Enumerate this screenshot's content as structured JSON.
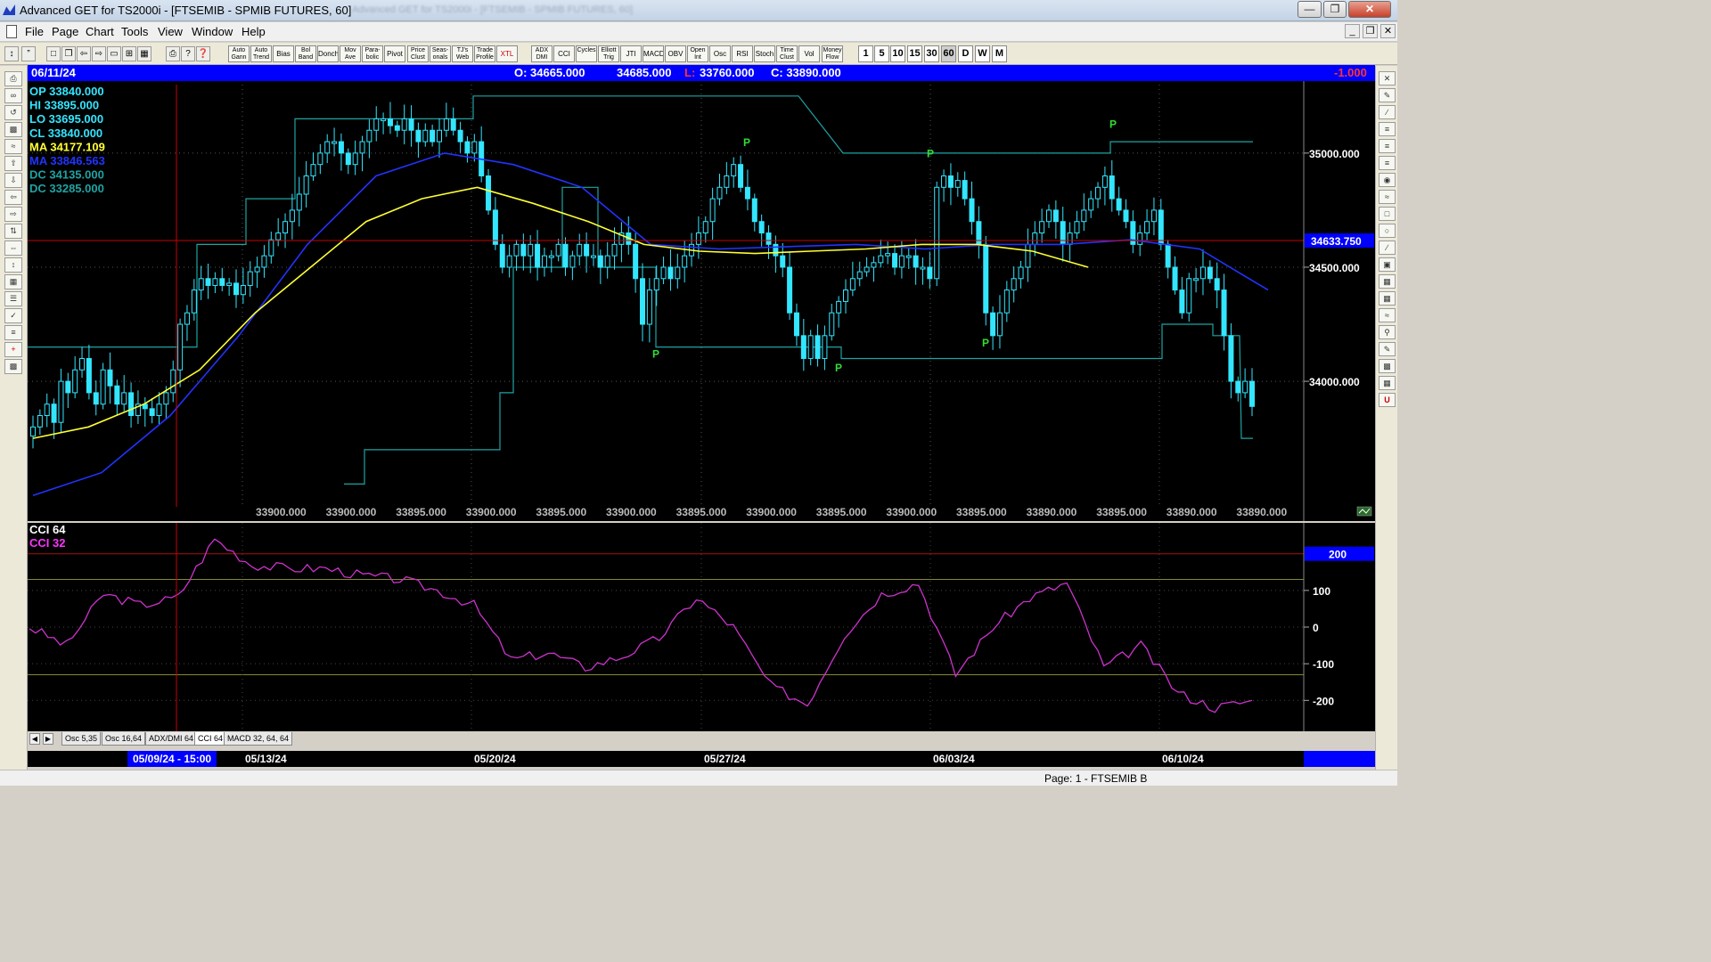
{
  "window": {
    "title": "Advanced GET for TS2000i - [FTSEMIB - SPMIB FUTURES, 60]",
    "blurred_text": "Advanced GET for TS2000i - [FTSEMIB - SPMIB FUTURES, 60]"
  },
  "menu": [
    "File",
    "Page",
    "Chart",
    "Tools",
    "View",
    "Window",
    "Help"
  ],
  "toolbar": {
    "studies": [
      "Auto Gann",
      "Auto Trend",
      "Bias",
      "Bol Band",
      "Donch",
      "Mov Ave",
      "Para-bolic",
      "Pivot",
      "Price Clust",
      "Seas-onals",
      "TJ's Web",
      "Trade Profile",
      "XTL",
      "ADX DMI",
      "CCI",
      "Cycles",
      "Elliott Trig",
      "JTI",
      "MACD",
      "OBV",
      "Open Int",
      "Osc",
      "RSI",
      "Stoch",
      "Time Clust",
      "Vol",
      "Money Flow"
    ],
    "timeframes": [
      "1",
      "5",
      "10",
      "15",
      "30",
      "60",
      "D",
      "W",
      "M"
    ],
    "active_timeframe": "60"
  },
  "infobar": {
    "date": "06/11/24",
    "open": "O: 34665.000",
    "high": "34685.000",
    "low_label": "L:",
    "low": "33760.000",
    "close": "C: 33890.000",
    "change": "-1.000"
  },
  "legend": [
    {
      "label": "OP",
      "value": "33840.000",
      "color": "#33e6ff"
    },
    {
      "label": "HI",
      "value": "33895.000",
      "color": "#33e6ff"
    },
    {
      "label": "LO",
      "value": "33695.000",
      "color": "#33e6ff"
    },
    {
      "label": "CL",
      "value": "33840.000",
      "color": "#33e6ff"
    },
    {
      "label": "MA",
      "value": "34177.109",
      "color": "#ffff33"
    },
    {
      "label": "MA",
      "value": "33846.563",
      "color": "#2233ff"
    },
    {
      "label": "DC",
      "value": "34135.000",
      "color": "#1fa3a3"
    },
    {
      "label": "DC",
      "value": "33285.000",
      "color": "#1fa3a3"
    }
  ],
  "price_axis": {
    "ticks": [
      "35000.000",
      "34500.000",
      "34000.000"
    ],
    "crosshair_label": "34633.750"
  },
  "bottom_values": [
    "33900.000",
    "33900.000",
    "33895.000",
    "33900.000",
    "33895.000",
    "33900.000",
    "33895.000",
    "33900.000",
    "33895.000",
    "33900.000",
    "33895.000",
    "33890.000",
    "33895.000",
    "33890.000",
    "33890.000"
  ],
  "pivot_label": "P",
  "indicator": {
    "titles": [
      "CCI 64",
      "CCI  32"
    ],
    "title_colors": [
      "#ffffff",
      "#ff33ff"
    ],
    "level_label": "200",
    "ticks": [
      "100",
      "0",
      "-100",
      "-200"
    ]
  },
  "tabs": [
    "Osc 5,35",
    "Osc 16,64",
    "ADX/DMI 64",
    "CCI 64",
    "MACD 32, 64, 64"
  ],
  "active_tab": "CCI 64",
  "dates": {
    "cursor": "05/09/24 - 15:00",
    "labels": [
      "05/13/24",
      "05/20/24",
      "05/27/24",
      "06/03/24",
      "06/10/24"
    ]
  },
  "status": "Page: 1 - FTSEMIB B",
  "colors": {
    "candle": "#33e6ff",
    "ma_fast": "#ffff33",
    "ma_slow": "#2233ff",
    "donchian": "#1fa3a3",
    "cci": "#cc33cc",
    "pivot": "#33dd33",
    "crosshair": "#cc0000",
    "infobar": "#0000ff",
    "change": "#ff3333"
  },
  "chart_data": {
    "type": "candlestick",
    "instrument": "FTSEMIB - SPMIB FUTURES",
    "interval": "60",
    "ylim": [
      33450,
      35300
    ],
    "date_markers": [
      "05/13/24",
      "05/20/24",
      "05/27/24",
      "06/03/24",
      "06/10/24"
    ],
    "series": [
      {
        "name": "Close",
        "values": [
          33800,
          33850,
          33900,
          33820,
          34000,
          33950,
          34050,
          34100,
          33950,
          33900,
          34050,
          33980,
          33900,
          33950,
          33850,
          33900,
          33880,
          33850,
          33900,
          33950,
          34050,
          34250,
          34300,
          34400,
          34450,
          34420,
          34450,
          34420,
          34430,
          34380,
          34420,
          34480,
          34500,
          34550,
          34620,
          34650,
          34700,
          34750,
          34820,
          34900,
          34950,
          35000,
          35050,
          35050,
          35000,
          34950,
          35000,
          35050,
          35100,
          35150,
          35150,
          35120,
          35100,
          35150,
          35100,
          35050,
          35100,
          35050,
          35100,
          35150,
          35100,
          35050,
          35000,
          35050,
          34900,
          34750,
          34600,
          34500,
          34550,
          34600,
          34550,
          34600,
          34500,
          34550,
          34550,
          34600,
          34500,
          34550,
          34600,
          34550,
          34550,
          34500,
          34550,
          34600,
          34650,
          34600,
          34450,
          34250,
          34400,
          34450,
          34500,
          34450,
          34500,
          34550,
          34600,
          34650,
          34700,
          34800,
          34850,
          34900,
          34950,
          34850,
          34800,
          34700,
          34650,
          34600,
          34550,
          34500,
          34300,
          34200,
          34100,
          34200,
          34100,
          34200,
          34300,
          34350,
          34400,
          34450,
          34480,
          34500,
          34520,
          34550,
          34560,
          34500,
          34550,
          34550,
          34500,
          34500,
          34450,
          34850,
          34900,
          34850,
          34880,
          34800,
          34700,
          34600,
          34300,
          34200,
          34300,
          34400,
          34450,
          34500,
          34600,
          34650,
          34700,
          34750,
          34700,
          34600,
          34650,
          34700,
          34750,
          34800,
          34850,
          34900,
          34800,
          34750,
          34700,
          34600,
          34650,
          34700,
          34750,
          34600,
          34500,
          34400,
          34300,
          34450,
          34450,
          34500,
          34450,
          34400,
          34200,
          34000,
          33950,
          34000,
          33890
        ]
      },
      {
        "name": "MA",
        "values": [
          33750,
          33800,
          33900,
          34050,
          34300,
          34500,
          34700,
          34800,
          34850,
          34780,
          34700,
          34600,
          34570,
          34560,
          34570,
          34580,
          34600,
          34600,
          34570,
          34500
        ]
      },
      {
        "name": "MA",
        "values": [
          33500,
          33600,
          33850,
          34200,
          34600,
          34900,
          35000,
          34950,
          34850,
          34600,
          34580,
          34590,
          34600,
          34580,
          34600,
          34600,
          34620,
          34580,
          34400
        ]
      },
      {
        "name": "CCI 64",
        "values": [
          0,
          -50,
          90,
          60,
          80,
          240,
          170,
          160,
          160,
          140,
          130,
          100,
          60,
          -90,
          -70,
          -110,
          -80,
          -30,
          80,
          0,
          -160,
          -210,
          -20,
          90,
          120,
          -130,
          0,
          80,
          120,
          -110,
          -50,
          -180,
          -220,
          -200
        ]
      }
    ]
  }
}
